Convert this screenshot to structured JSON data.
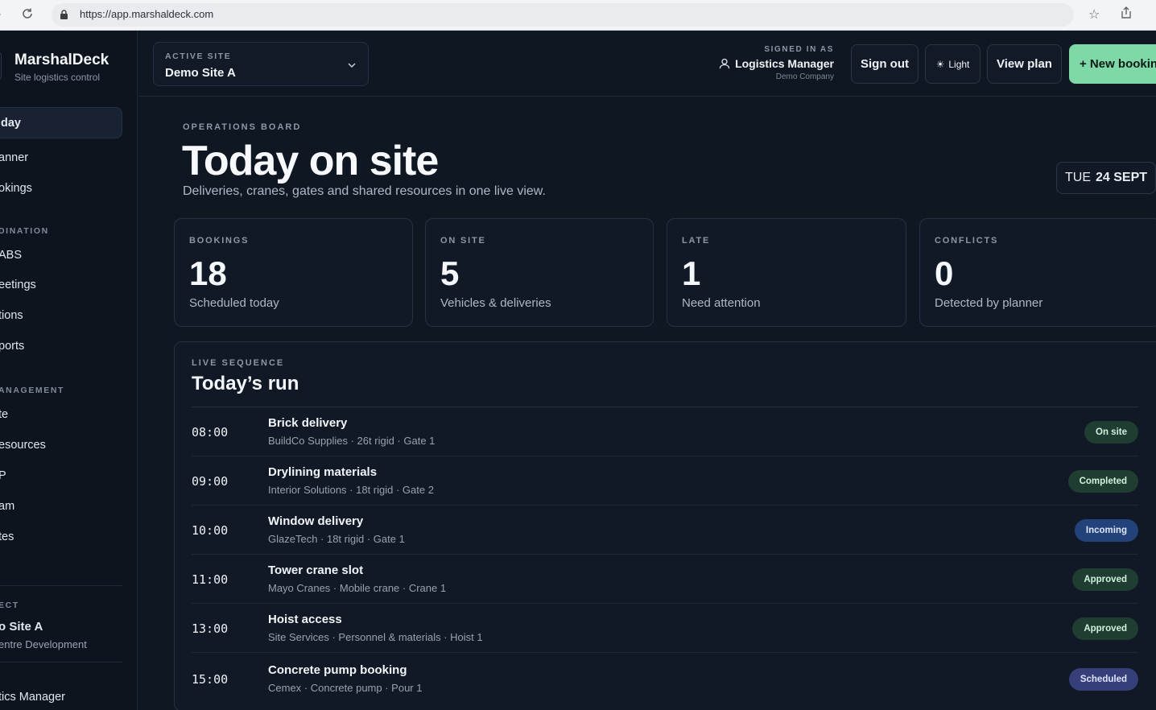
{
  "browser": {
    "url": "https://app.marshaldeck.com"
  },
  "brand": {
    "name": "MarshalDeck",
    "tagline": "Site logistics control"
  },
  "sidebar": {
    "items_top": [
      "day",
      "anner",
      "okings"
    ],
    "section_coordination": "DINATION",
    "items_coordination": [
      "ABS",
      "eetings",
      "tions",
      "ports"
    ],
    "section_management": "ANAGEMENT",
    "items_management": [
      "te",
      "esources",
      "P",
      "am",
      "tes"
    ],
    "section_project": "ECT",
    "project_name": "o Site A",
    "project_sub": "entre Development",
    "user": "tics Manager"
  },
  "topbar": {
    "site_label": "ACTIVE SITE",
    "site_value": "Demo Site A",
    "signed_label": "SIGNED IN AS",
    "user_role": "Logistics Manager",
    "company": "Demo Company",
    "sign_out": "Sign out",
    "light": "Light",
    "view_plan": "View plan",
    "new_booking": "+ New bookin"
  },
  "header": {
    "eyebrow": "OPERATIONS BOARD",
    "title": "Today on site",
    "subtitle": "Deliveries, cranes, gates and shared resources in one live view.",
    "date_day": "TUE",
    "date_value": "24 SEPT"
  },
  "stats": [
    {
      "label": "BOOKINGS",
      "value": "18",
      "caption": "Scheduled today"
    },
    {
      "label": "ON SITE",
      "value": "5",
      "caption": "Vehicles & deliveries"
    },
    {
      "label": "LATE",
      "value": "1",
      "caption": "Need attention"
    },
    {
      "label": "CONFLICTS",
      "value": "0",
      "caption": "Detected by planner"
    }
  ],
  "run": {
    "eyebrow": "LIVE SEQUENCE",
    "title": "Today’s run",
    "rows": [
      {
        "time": "08:00",
        "name": "Brick delivery",
        "meta": "BuildCo Supplies · 26t rigid · Gate 1",
        "status": "On site"
      },
      {
        "time": "09:00",
        "name": "Drylining materials",
        "meta": "Interior Solutions · 18t rigid · Gate 2",
        "status": "Completed"
      },
      {
        "time": "10:00",
        "name": "Window delivery",
        "meta": "GlazeTech · 18t rigid · Gate 1",
        "status": "Incoming"
      },
      {
        "time": "11:00",
        "name": "Tower crane slot",
        "meta": "Mayo Cranes · Mobile crane · Crane 1",
        "status": "Approved"
      },
      {
        "time": "13:00",
        "name": "Hoist access",
        "meta": "Site Services · Personnel & materials · Hoist 1",
        "status": "Approved"
      },
      {
        "time": "15:00",
        "name": "Concrete pump booking",
        "meta": "Cemex · Concrete pump · Pour 1",
        "status": "Scheduled"
      }
    ]
  },
  "colors": {
    "accent": "#7ed8a8",
    "status_green": "#1f3d30",
    "status_blue": "#23427a",
    "status_indigo": "#363f79"
  }
}
